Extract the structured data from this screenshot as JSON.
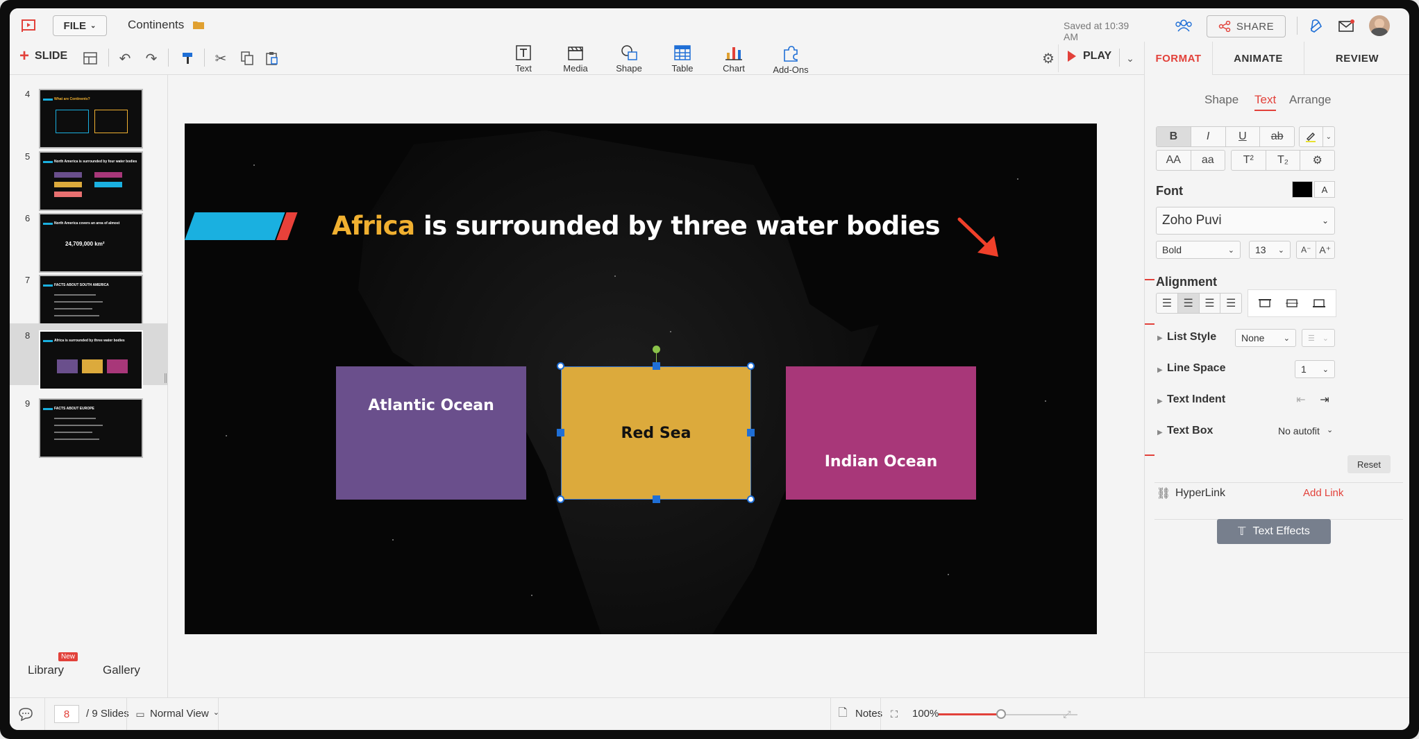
{
  "app": {
    "file_menu": "FILE",
    "doc_title": "Continents",
    "saved_status": "Saved at 10:39 AM",
    "share_label": "SHARE",
    "slide_button": "SLIDE",
    "play_label": "PLAY"
  },
  "insert_tools": [
    {
      "label": "Text",
      "icon": "text-box-icon"
    },
    {
      "label": "Media",
      "icon": "clapper-icon"
    },
    {
      "label": "Shape",
      "icon": "shape-icon"
    },
    {
      "label": "Table",
      "icon": "table-icon"
    },
    {
      "label": "Chart",
      "icon": "bar-chart-icon"
    },
    {
      "label": "Add-Ons",
      "icon": "puzzle-icon"
    }
  ],
  "thumbnails": [
    {
      "num": "4",
      "title": "What are Continents?"
    },
    {
      "num": "5",
      "title": "North America is surrounded by four water bodies"
    },
    {
      "num": "6",
      "title": "North America covers an area of almost",
      "value": "24,709,000 km²"
    },
    {
      "num": "7",
      "title": "FACTS ABOUT SOUTH AMERICA"
    },
    {
      "num": "8",
      "title": "Africa is surrounded by three water bodies"
    },
    {
      "num": "9",
      "title": "FACTS ABOUT EUROPE"
    }
  ],
  "left_footer": {
    "library": "Library",
    "library_badge": "New",
    "gallery": "Gallery"
  },
  "slide": {
    "title_highlight": "Africa",
    "title_rest": " is surrounded by three water bodies",
    "boxes": [
      {
        "label": "Atlantic Ocean",
        "color": "#6a4f8c"
      },
      {
        "label": "Red Sea",
        "color": "#dcaa3c"
      },
      {
        "label": "Indian Ocean",
        "color": "#a83779"
      }
    ]
  },
  "format_panel": {
    "tabs": [
      "FORMAT",
      "ANIMATE",
      "REVIEW"
    ],
    "subtabs": [
      "Shape",
      "Text",
      "Arrange"
    ],
    "style_buttons": [
      "B",
      "I",
      "U",
      "ab"
    ],
    "case_buttons": [
      "AA",
      "aa",
      "T²",
      "T₂"
    ],
    "font_label": "Font",
    "font_name": "Zoho Puvi",
    "font_weight": "Bold",
    "font_size": "13",
    "alignment_label": "Alignment",
    "list_style_label": "List Style",
    "list_style_value": "None",
    "line_space_label": "Line Space",
    "line_space_value": "1",
    "text_indent_label": "Text Indent",
    "text_box_label": "Text Box",
    "text_box_value": "No autofit",
    "reset_label": "Reset",
    "hyperlink_label": "HyperLink",
    "add_link_label": "Add Link",
    "text_effects_label": "Text Effects"
  },
  "statusbar": {
    "current_page": "8",
    "total_slides": "/ 9 Slides",
    "view_mode": "Normal View",
    "notes_label": "Notes",
    "zoom": "100%",
    "zoom_level": 0.45
  },
  "colors": {
    "accent": "#e2413a",
    "title_highlight": "#f0b030"
  }
}
